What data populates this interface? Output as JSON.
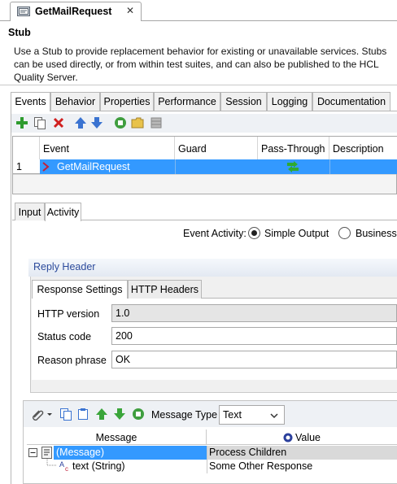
{
  "editor_tab": {
    "title": "GetMailRequest",
    "close_glyph": "✕",
    "icon": "stub-icon"
  },
  "header": {
    "title": "Stub",
    "description": "Use a Stub to provide replacement behavior for existing or unavailable services. Stubs can be used directly, or from within test suites, and can also be published to the HCL Quality Server."
  },
  "main_tabs": [
    "Events",
    "Behavior",
    "Properties",
    "Performance",
    "Session",
    "Logging",
    "Documentation"
  ],
  "toolbar": {
    "icons": [
      "add-icon",
      "copy-icon",
      "delete-icon",
      "move-up-icon",
      "move-down-icon",
      "disable-icon",
      "open-folder-icon",
      "grid-icon"
    ]
  },
  "events_table": {
    "columns": [
      "Event",
      "Guard",
      "Pass-Through",
      "Description"
    ],
    "rows": [
      {
        "index": "1",
        "event": "GetMailRequest",
        "guard": "",
        "pass_through_icon": "pass-through-icon",
        "description": ""
      }
    ]
  },
  "sub_tabs": [
    "Input",
    "Activity"
  ],
  "event_activity": {
    "label": "Event Activity:",
    "options": [
      "Simple Output",
      "Business"
    ],
    "selected": "Simple Output"
  },
  "reply_header": {
    "title": "Reply Header",
    "tabs": [
      "Response Settings",
      "HTTP Headers"
    ],
    "fields": [
      {
        "label": "HTTP version",
        "value": "1.0"
      },
      {
        "label": "Status code",
        "value": "200"
      },
      {
        "label": "Reason phrase",
        "value": "OK"
      }
    ]
  },
  "message": {
    "toolbar_icons": [
      "attach-icon",
      "dropdown-arrow-icon",
      "copy-icon",
      "paste-icon",
      "move-up-icon",
      "move-down-icon",
      "disable-icon"
    ],
    "type_label": "Message Type",
    "type_value": "Text",
    "columns": [
      "Message",
      "Value"
    ],
    "tree": [
      {
        "label": "(Message)",
        "value": "Process Children"
      },
      {
        "label": "text (String)",
        "value": "Some Other Response"
      }
    ]
  },
  "colors": {
    "selection": "#3399ff",
    "link": "#2c4b9c"
  }
}
